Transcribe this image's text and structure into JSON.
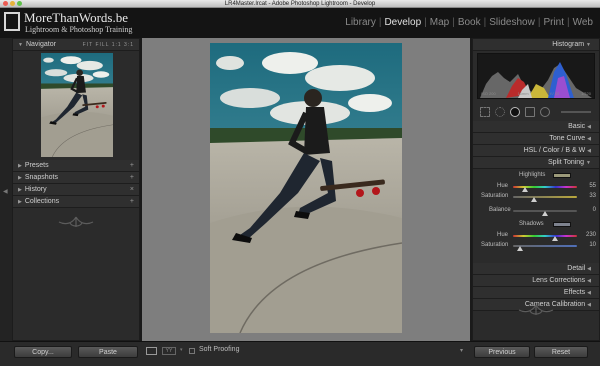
{
  "window": {
    "title": "LR4Master.lrcat - Adobe Photoshop Lightroom - Develop"
  },
  "brand": {
    "title": "MoreThanWords.be",
    "subtitle": "Lightroom & Photoshop Training"
  },
  "modules": [
    {
      "label": "Library",
      "active": false
    },
    {
      "label": "Develop",
      "active": true
    },
    {
      "label": "Map",
      "active": false
    },
    {
      "label": "Book",
      "active": false
    },
    {
      "label": "Slideshow",
      "active": false
    },
    {
      "label": "Print",
      "active": false
    },
    {
      "label": "Web",
      "active": false
    }
  ],
  "left": {
    "navigator": {
      "label": "Navigator",
      "zoom": [
        "FIT",
        "FILL",
        "1:1",
        "3:1"
      ]
    },
    "sections": [
      {
        "label": "Presets",
        "control": "+"
      },
      {
        "label": "Snapshots",
        "control": "+"
      },
      {
        "label": "History",
        "control": "×"
      },
      {
        "label": "Collections",
        "control": "+"
      }
    ],
    "copy_label": "Copy...",
    "paste_label": "Paste"
  },
  "right": {
    "histogram_label": "Histogram",
    "readout": [
      "ISO 200",
      "16mm",
      "f / 22",
      "1/320"
    ],
    "panels": [
      "Basic",
      "Tone Curve"
    ],
    "hsl": {
      "hsl": "HSL",
      "color": "Color",
      "bw": "B & W"
    },
    "split_toning": {
      "label": "Split Toning",
      "highlights_label": "Highlights",
      "highlights_hue": "55",
      "highlights_saturation": "33",
      "balance_label": "Balance",
      "balance_value": "0",
      "shadows_label": "Shadows",
      "shadows_hue": "230",
      "shadows_saturation": "10",
      "hue_label": "Hue",
      "saturation_label": "Saturation"
    },
    "panels_after": [
      "Detail",
      "Lens Corrections",
      "Effects",
      "Camera Calibration"
    ],
    "previous_label": "Previous",
    "reset_label": "Reset"
  },
  "toolbar": {
    "soft_proofing": "Soft Proofing"
  },
  "colors": {
    "panel": "#2b2b2b",
    "center_bg": "#7e7e7e",
    "active_module": "#e0e0e0"
  }
}
